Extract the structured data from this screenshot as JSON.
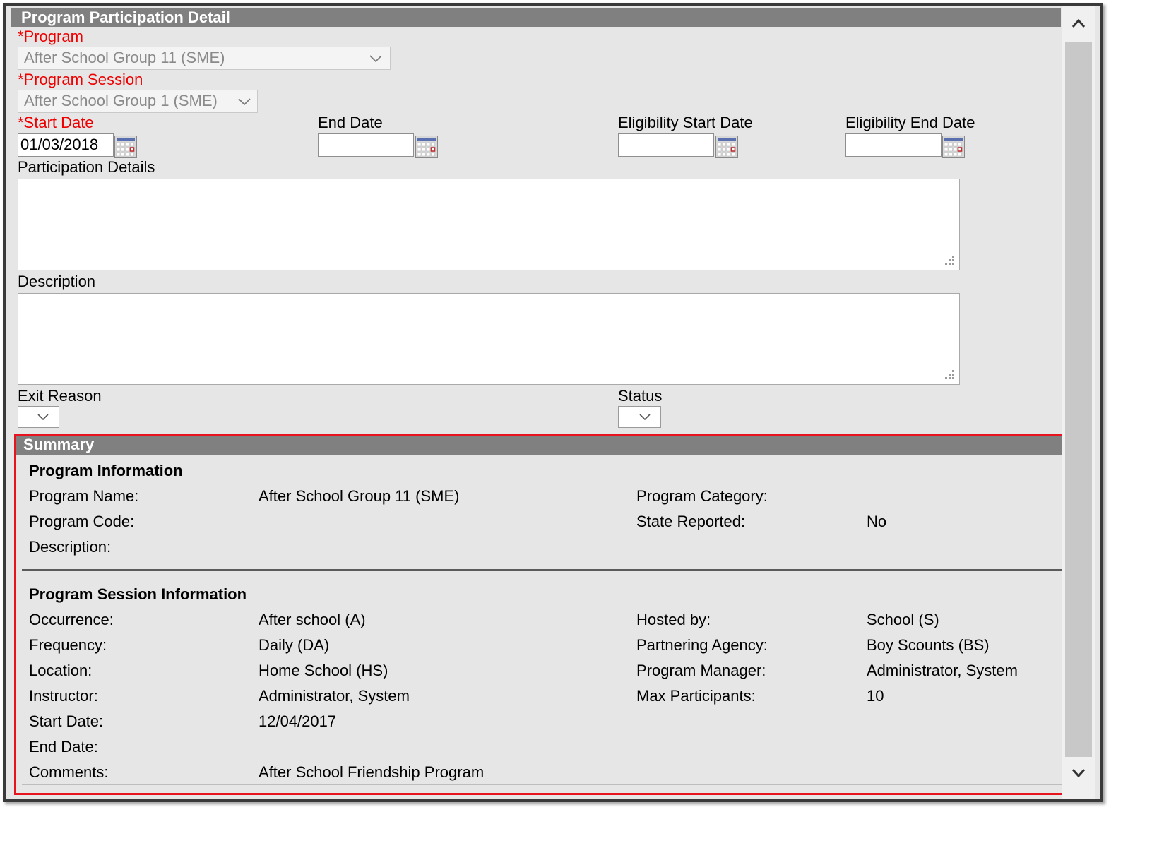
{
  "detail": {
    "header": "Program Participation Detail",
    "program": {
      "label": "*Program",
      "value": "After School Group 11 (SME)"
    },
    "session": {
      "label": "*Program Session",
      "value": "After School Group 1 (SME)"
    },
    "start_date": {
      "label": "*Start Date",
      "value": "01/03/2018"
    },
    "end_date": {
      "label": "End Date",
      "value": ""
    },
    "elig_start": {
      "label": "Eligibility Start Date",
      "value": ""
    },
    "elig_end": {
      "label": "Eligibility End Date",
      "value": ""
    },
    "participation_details": {
      "label": "Participation Details"
    },
    "description": {
      "label": "Description"
    },
    "exit_reason": {
      "label": "Exit Reason",
      "value": ""
    },
    "status": {
      "label": "Status",
      "value": ""
    }
  },
  "summary": {
    "header": "Summary",
    "program_info": {
      "title": "Program Information",
      "left": [
        {
          "label": "Program Name:",
          "value": "After School Group 11 (SME)"
        },
        {
          "label": "Program Code:",
          "value": ""
        },
        {
          "label": "Description:",
          "value": ""
        }
      ],
      "right": [
        {
          "label": "Program Category:",
          "value": ""
        },
        {
          "label": "State Reported:",
          "value": "No"
        }
      ]
    },
    "session_info": {
      "title": "Program Session Information",
      "left": [
        {
          "label": "Occurrence:",
          "value": "After school (A)"
        },
        {
          "label": "Frequency:",
          "value": "Daily (DA)"
        },
        {
          "label": "Location:",
          "value": "Home School (HS)"
        },
        {
          "label": "Instructor:",
          "value": "Administrator, System"
        },
        {
          "label": "Start Date:",
          "value": "12/04/2017"
        },
        {
          "label": "End Date:",
          "value": ""
        },
        {
          "label": "Comments:",
          "value": "After School Friendship Program"
        }
      ],
      "right": [
        {
          "label": "Hosted by:",
          "value": "School (S)"
        },
        {
          "label": "Partnering Agency:",
          "value": "Boy Scounts (BS)"
        },
        {
          "label": "Program Manager:",
          "value": "Administrator, System"
        },
        {
          "label": "Max Participants:",
          "value": "10"
        }
      ]
    }
  },
  "icons": {
    "calendar": "calendar-icon",
    "chevron": "chevron-down-icon",
    "resize": "resize-grip-icon",
    "scroll_up": "chevron-up-icon",
    "scroll_down": "chevron-down-icon"
  },
  "colors": {
    "required": "#ee0000",
    "header": "#808080",
    "highlight": "#e8141d",
    "panel": "#e6e6e6"
  }
}
